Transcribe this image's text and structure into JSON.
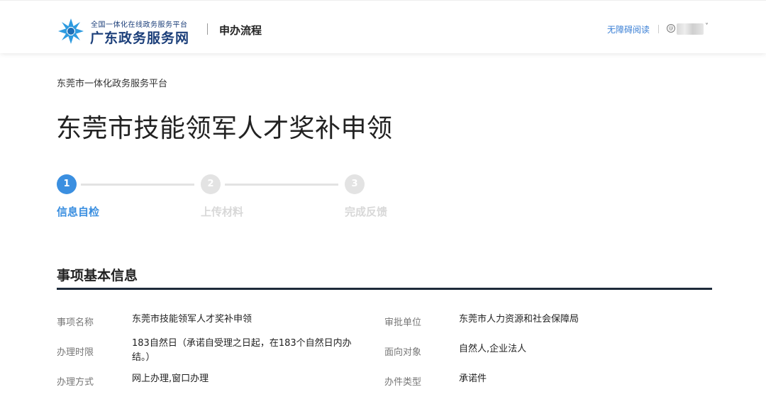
{
  "header": {
    "logo_small_text": "全国一体化在线政务服务平台",
    "logo_big_text": "广东政务服务网",
    "nav_title": "申办流程",
    "accessibility_link": "无障碍阅读",
    "user_icon_glyph": "@",
    "user_caret": "˅",
    "logo_color": "#2e9be0"
  },
  "breadcrumb": "东莞市一体化政务服务平台",
  "page_title": "东莞市技能领军人才奖补申领",
  "steps": [
    {
      "number": "1",
      "label": "信息自检",
      "state": "active"
    },
    {
      "number": "2",
      "label": "上传材料",
      "state": "inactive"
    },
    {
      "number": "3",
      "label": "完成反馈",
      "state": "inactive"
    }
  ],
  "section": {
    "title": "事项基本信息",
    "rows": [
      {
        "label": "事项名称",
        "value": "东莞市技能领军人才奖补申领"
      },
      {
        "label": "审批单位",
        "value": "东莞市人力资源和社会保障局"
      },
      {
        "label": "办理时限",
        "value": "183自然日（承诺自受理之日起，在183个自然日内办结。）"
      },
      {
        "label": "面向对象",
        "value": "自然人,企业法人"
      },
      {
        "label": "办理方式",
        "value": "网上办理,窗口办理"
      },
      {
        "label": "办件类型",
        "value": "承诺件"
      }
    ]
  },
  "colors": {
    "accent": "#3b8fe0",
    "inactive": "#e3e3e3",
    "brand_text": "#1c3f7a"
  }
}
